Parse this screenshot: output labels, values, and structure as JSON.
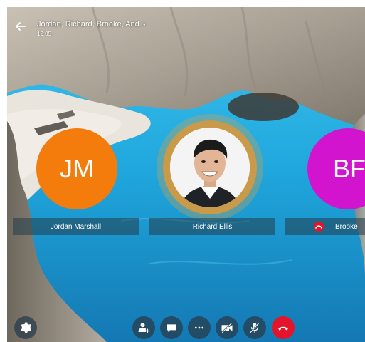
{
  "header": {
    "title": "Jordan, Richard, Brooke, And.",
    "title_chevron": "▾",
    "time": "12:05"
  },
  "participants": [
    {
      "initials": "JM",
      "name": "Jordan Marshall",
      "color": "#f37c0d"
    },
    {
      "initials": "",
      "name": "Richard Ellis",
      "ring_color": "#c99a4a",
      "speaking": true
    },
    {
      "initials": "BF",
      "name": "Brooke",
      "color": "#d214cf",
      "muted": true
    }
  ],
  "controls": [
    {
      "icon": "gear-icon"
    },
    {
      "icon": "add-person-icon"
    },
    {
      "icon": "chat-icon"
    },
    {
      "icon": "more-icon"
    },
    {
      "icon": "video-off-icon"
    },
    {
      "icon": "mic-off-icon"
    },
    {
      "icon": "end-call-icon",
      "color": "#e4142b"
    }
  ]
}
